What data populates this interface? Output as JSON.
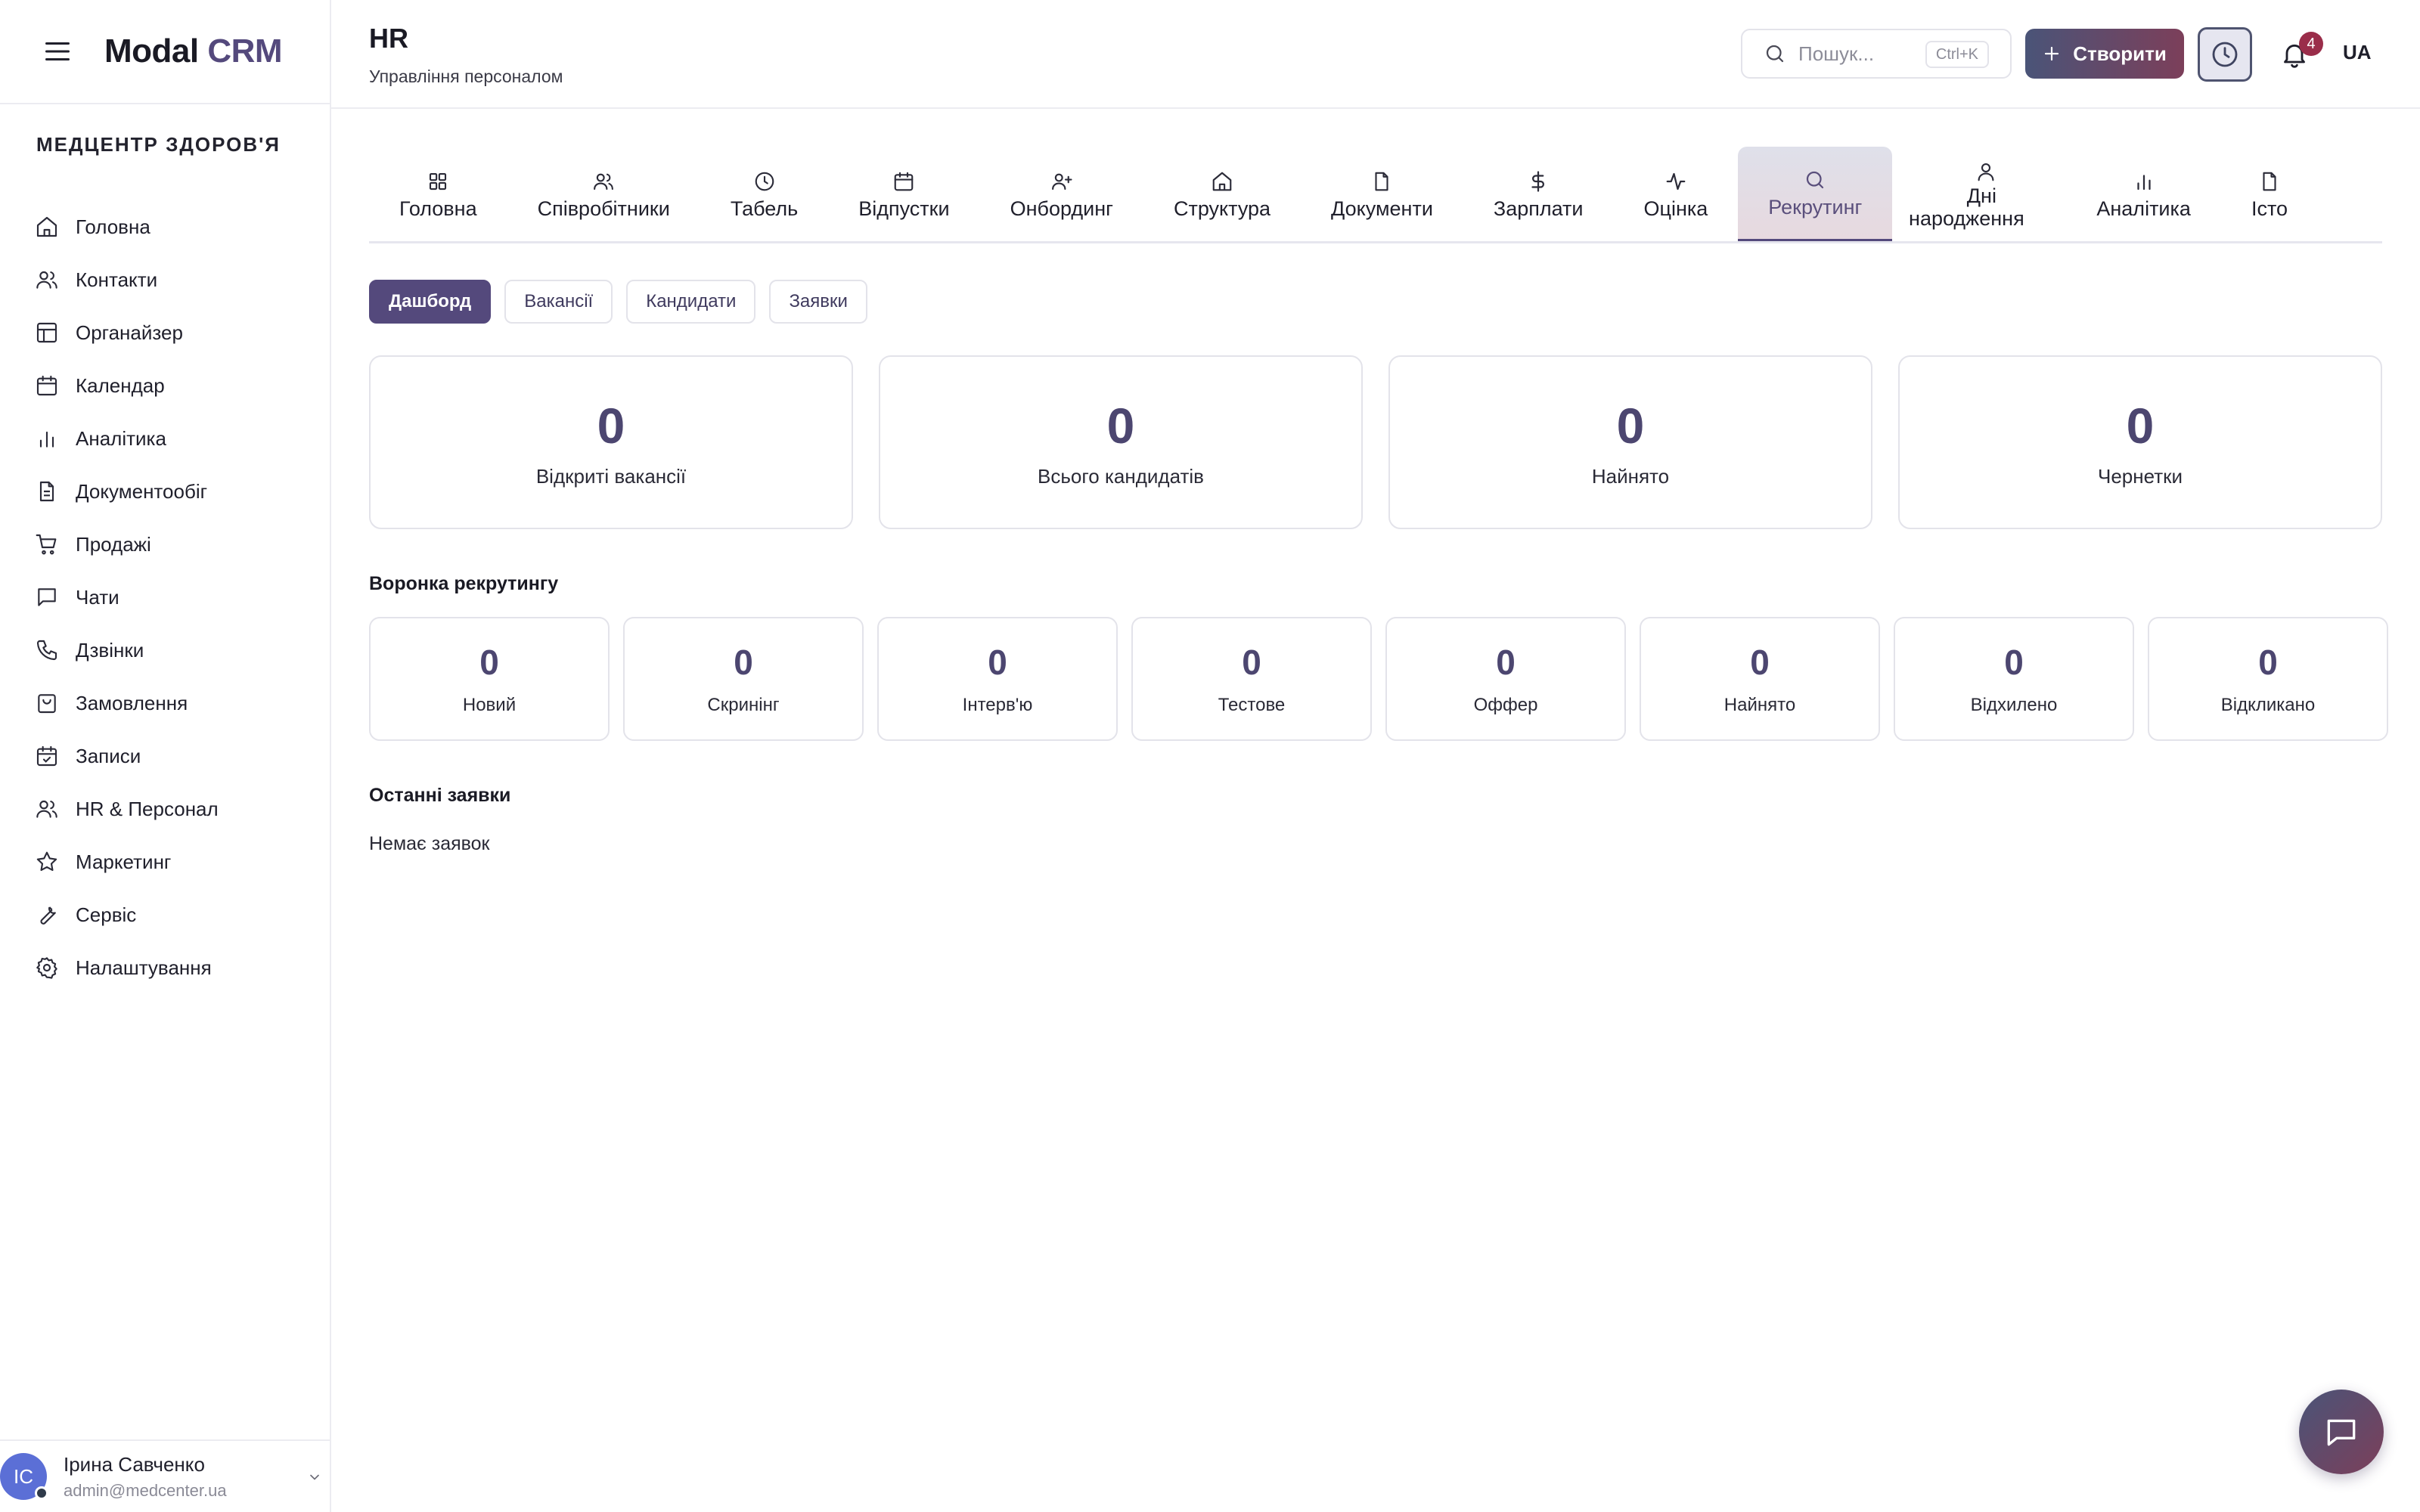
{
  "app": {
    "logo_main": "Modal",
    "logo_accent": "CRM"
  },
  "sidebar": {
    "org_name": "МЕДЦЕНТР ЗДОРОВ'Я",
    "items": [
      {
        "label": "Головна",
        "icon": "home-icon"
      },
      {
        "label": "Контакти",
        "icon": "users-icon"
      },
      {
        "label": "Органайзер",
        "icon": "layout-icon"
      },
      {
        "label": "Календар",
        "icon": "calendar-icon"
      },
      {
        "label": "Аналітика",
        "icon": "bar-chart-icon"
      },
      {
        "label": "Документообіг",
        "icon": "file-text-icon"
      },
      {
        "label": "Продажі",
        "icon": "cart-icon"
      },
      {
        "label": "Чати",
        "icon": "message-icon"
      },
      {
        "label": "Дзвінки",
        "icon": "phone-icon"
      },
      {
        "label": "Замовлення",
        "icon": "shopping-bag-icon"
      },
      {
        "label": "Записи",
        "icon": "calendar-check-icon"
      },
      {
        "label": "HR & Персонал",
        "icon": "users-icon"
      },
      {
        "label": "Маркетинг",
        "icon": "star-icon"
      },
      {
        "label": "Сервіс",
        "icon": "wrench-icon"
      },
      {
        "label": "Налаштування",
        "icon": "gear-icon"
      }
    ],
    "user": {
      "initials": "IC",
      "name": "Ірина Савченко",
      "email": "admin@medcenter.ua"
    }
  },
  "header": {
    "title": "HR",
    "subtitle": "Управління персоналом",
    "search_placeholder": "Пошук...",
    "search_shortcut": "Ctrl+K",
    "create_label": "Створити",
    "notifications_count": "4",
    "language": "UA"
  },
  "tabs": [
    {
      "label": "Головна",
      "icon": "grid-icon"
    },
    {
      "label": "Співробітники",
      "icon": "users-icon"
    },
    {
      "label": "Табель",
      "icon": "clock-icon"
    },
    {
      "label": "Відпустки",
      "icon": "calendar-icon"
    },
    {
      "label": "Онбординг",
      "icon": "user-plus-icon"
    },
    {
      "label": "Структура",
      "icon": "home-icon"
    },
    {
      "label": "Документи",
      "icon": "file-icon"
    },
    {
      "label": "Зарплати",
      "icon": "dollar-icon"
    },
    {
      "label": "Оцінка",
      "icon": "activity-icon"
    },
    {
      "label": "Рекрутинг",
      "icon": "search-icon",
      "active": true
    },
    {
      "label": "Дні народження",
      "icon": "user-icon"
    },
    {
      "label": "Аналітика",
      "icon": "bar-chart-icon"
    },
    {
      "label": "Істо",
      "icon": "file-icon"
    }
  ],
  "subtabs": [
    {
      "label": "Дашборд",
      "active": true
    },
    {
      "label": "Вакансії"
    },
    {
      "label": "Кандидати"
    },
    {
      "label": "Заявки"
    }
  ],
  "stats": [
    {
      "value": "0",
      "label": "Відкриті вакансії"
    },
    {
      "value": "0",
      "label": "Всього кандидатів"
    },
    {
      "value": "0",
      "label": "Найнято"
    },
    {
      "value": "0",
      "label": "Чернетки"
    }
  ],
  "funnel": {
    "title": "Воронка рекрутингу",
    "stages": [
      {
        "value": "0",
        "label": "Новий"
      },
      {
        "value": "0",
        "label": "Скринінг"
      },
      {
        "value": "0",
        "label": "Інтерв'ю"
      },
      {
        "value": "0",
        "label": "Тестове"
      },
      {
        "value": "0",
        "label": "Оффер"
      },
      {
        "value": "0",
        "label": "Найнято"
      },
      {
        "value": "0",
        "label": "Відхилено"
      },
      {
        "value": "0",
        "label": "Відкликано"
      }
    ]
  },
  "recent": {
    "title": "Останні заявки",
    "empty_text": "Немає заявок"
  }
}
